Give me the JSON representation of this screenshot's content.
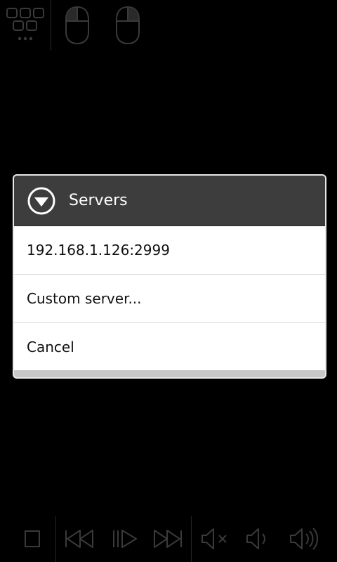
{
  "top_bar": {
    "icons": [
      "keypad-icon",
      "mouse-left-button-icon",
      "mouse-right-button-icon"
    ]
  },
  "dialog": {
    "title": "Servers",
    "header_icon": "chevron-down-circle-icon",
    "items": [
      {
        "label": "192.168.1.126:2999"
      },
      {
        "label": "Custom server..."
      },
      {
        "label": "Cancel"
      }
    ]
  },
  "bottom_bar": {
    "icons": [
      "stop-icon",
      "previous-track-icon",
      "play-pause-icon",
      "next-track-icon",
      "mute-icon",
      "volume-down-icon",
      "volume-up-icon"
    ]
  },
  "colors": {
    "background": "#000000",
    "dialog_header": "#3d3d3d",
    "dialog_body": "#ffffff",
    "icon_dim": "#3a3a3a"
  }
}
